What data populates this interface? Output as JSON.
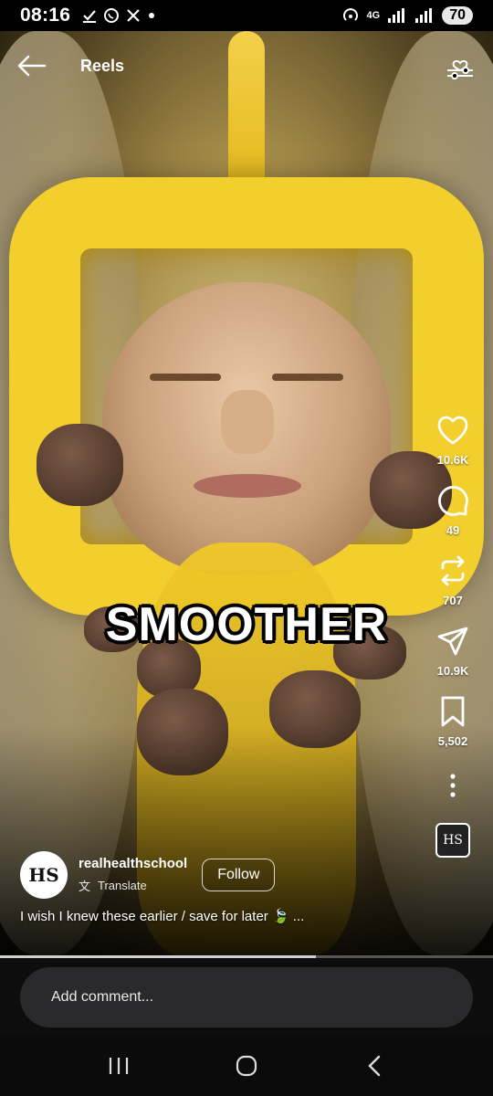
{
  "status_bar": {
    "time": "08:16",
    "left_icons": [
      "download-check-icon",
      "whatsapp-icon",
      "x-icon",
      "dot-icon"
    ],
    "network": "4G",
    "battery": "70"
  },
  "header": {
    "title": "Reels"
  },
  "video": {
    "overlay_caption": "SMOOTHER",
    "progress_fraction": 0.64
  },
  "actions": {
    "likes": "10.6K",
    "comments": "49",
    "reposts": "707",
    "shares": "10.9K",
    "saves": "5,502"
  },
  "author": {
    "avatar_text": "HS",
    "name": "realhealthschool",
    "translate_label": "Translate",
    "follow_label": "Follow"
  },
  "description": "I wish I knew these earlier / save for later 🍃 ...",
  "comment": {
    "placeholder": "Add comment..."
  },
  "audio": {
    "thumb_text": "HS"
  },
  "nav": {
    "icons": [
      "recent-apps-icon",
      "home-icon",
      "back-icon"
    ]
  }
}
